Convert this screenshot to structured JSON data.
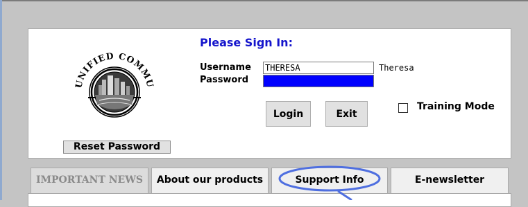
{
  "login": {
    "title": "Please Sign In:",
    "username_label": "Username",
    "password_label": "Password",
    "username_value": "THERESA",
    "current_user": "Theresa",
    "login_label": "Login",
    "exit_label": "Exit",
    "training_mode_label": "Training Mode",
    "training_mode_checked": false,
    "reset_password_label": "Reset Password"
  },
  "logo": {
    "arc_text": "THE UNIFIED COMMUNITY"
  },
  "tabs": [
    {
      "label": "IMPORTANT NEWS",
      "state": "disabled"
    },
    {
      "label": "About our products",
      "state": "normal"
    },
    {
      "label": "Support Info",
      "state": "highlighted"
    },
    {
      "label": "E-newsletter",
      "state": "normal"
    }
  ],
  "colors": {
    "title": "#1515cc",
    "password_fill": "#0000ff",
    "annotation": "#4f6fe0",
    "background": "#c4c4c4"
  }
}
